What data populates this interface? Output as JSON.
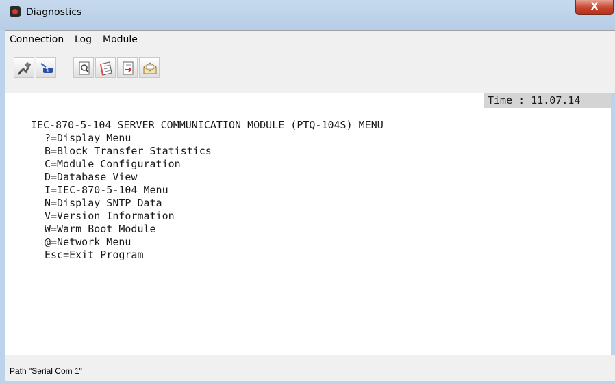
{
  "window": {
    "title": "Diagnostics",
    "close_label": "X"
  },
  "menubar": {
    "items": [
      "Connection",
      "Log",
      "Module"
    ]
  },
  "toolbar": {
    "buttons": [
      {
        "icon": "disconnect-plug-icon"
      },
      {
        "icon": "serial-port-icon"
      },
      {
        "icon": "magnifier-document-icon"
      },
      {
        "icon": "notebook-icon"
      },
      {
        "icon": "document-transfer-icon"
      },
      {
        "icon": "open-envelope-icon"
      }
    ]
  },
  "terminal": {
    "time": "Time : 11.07.14",
    "menu_title": "IEC-870-5-104 SERVER COMMUNICATION MODULE (PTQ-104S) MENU",
    "menu_lines": [
      "?=Display Menu",
      "B=Block Transfer Statistics",
      "C=Module Configuration",
      "D=Database View",
      "I=IEC-870-5-104 Menu",
      "N=Display SNTP Data",
      "V=Version Information",
      "W=Warm Boot Module",
      "@=Network Menu",
      "Esc=Exit Program"
    ]
  },
  "status": {
    "path": "Path \"Serial Com 1\""
  },
  "colors": {
    "titlebar": "#bcd3ea",
    "close_button": "#c6432c",
    "time_background": "#d4d4d4",
    "chrome": "#f0f0f0"
  }
}
